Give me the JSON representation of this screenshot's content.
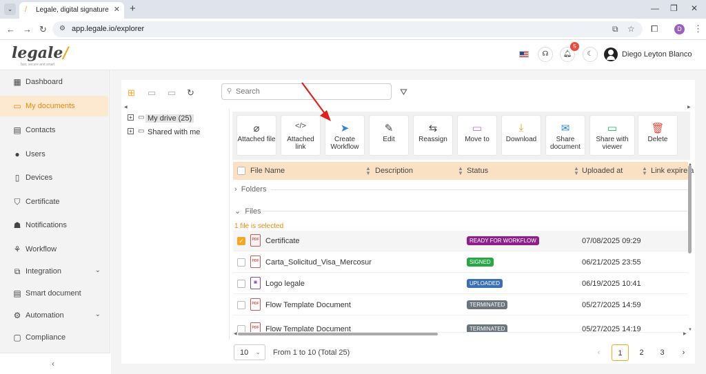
{
  "browser": {
    "tab_title": "Legale, digital signature",
    "tab_close": "✕",
    "new_tab": "+",
    "url": "app.legale.io/explorer",
    "profile_initial": "D"
  },
  "header": {
    "logo_text": "legale",
    "logo_mark": "/",
    "logo_tagline": "fast, secure and smart",
    "notification_count": "5",
    "user_name": "Diego Leyton Blanco"
  },
  "sidebar": {
    "items": [
      {
        "label": "Dashboard",
        "icon": "dashboard-icon"
      },
      {
        "label": "My documents",
        "icon": "folder-icon"
      },
      {
        "label": "Contacts",
        "icon": "contacts-icon"
      },
      {
        "label": "Users",
        "icon": "user-icon"
      },
      {
        "label": "Devices",
        "icon": "device-icon"
      },
      {
        "label": "Certificate",
        "icon": "shield-check-icon"
      },
      {
        "label": "Notifications",
        "icon": "bell-icon"
      },
      {
        "label": "Workflow",
        "icon": "workflow-icon"
      },
      {
        "label": "Integration",
        "icon": "external-link-icon"
      },
      {
        "label": "Smart document",
        "icon": "document-icon"
      },
      {
        "label": "Automation",
        "icon": "gear-icon"
      },
      {
        "label": "Compliance",
        "icon": "chat-icon"
      }
    ],
    "collapse_glyph": "‹"
  },
  "toolbar": {
    "search_placeholder": "Search"
  },
  "tree": {
    "my_drive": "My drive (25)",
    "shared": "Shared with me"
  },
  "actions": [
    {
      "label": "Attached file",
      "icon": "paperclip-icon",
      "glyph": "⌀",
      "color": "#444444"
    },
    {
      "label": "Attached link",
      "icon": "code-icon",
      "glyph": "</>",
      "color": "#444444"
    },
    {
      "label": "Create Workflow",
      "icon": "send-icon",
      "glyph": "➤",
      "color": "#2e86de"
    },
    {
      "label": "Edit",
      "icon": "edit-icon",
      "glyph": "✎",
      "color": "#444444"
    },
    {
      "label": "Reassign",
      "icon": "reassign-icon",
      "glyph": "⇆",
      "color": "#444444"
    },
    {
      "label": "Move to",
      "icon": "move-folder-icon",
      "glyph": "▭",
      "color": "#c56cd6"
    },
    {
      "label": "Download",
      "icon": "download-icon",
      "glyph": "⤓",
      "color": "#f39c12"
    },
    {
      "label": "Share document",
      "icon": "mail-icon",
      "glyph": "✉",
      "color": "#2e86de"
    },
    {
      "label": "Share with viewer",
      "icon": "share-folder-icon",
      "glyph": "▭",
      "color": "#27ae60"
    },
    {
      "label": "Delete",
      "icon": "trash-icon",
      "glyph": "🗑",
      "color": "#e74c3c"
    }
  ],
  "table": {
    "headers": {
      "file_name": "File Name",
      "description": "Description",
      "status": "Status",
      "uploaded_at": "Uploaded at",
      "link_expire": "Link expire a"
    },
    "folders_label": "Folders",
    "files_label": "Files",
    "selection_info": "1 file is selected",
    "rows": [
      {
        "name": "Certificate",
        "type": "pdf",
        "status": "READY FOR WORKFLOW",
        "status_color": "#8e1f8c",
        "uploaded_at": "07/08/2025 09:29",
        "checked": true
      },
      {
        "name": "Carta_Solicitud_Visa_Mercosur",
        "type": "pdf",
        "status": "SIGNED",
        "status_color": "#27a844",
        "uploaded_at": "06/21/2025 23:55",
        "checked": false
      },
      {
        "name": "Logo legale",
        "type": "img",
        "status": "UPLOADED",
        "status_color": "#3a6fb7",
        "uploaded_at": "06/19/2025 10:41",
        "checked": false
      },
      {
        "name": "Flow Template Document",
        "type": "pdf",
        "status": "TERMINATED",
        "status_color": "#6c757d",
        "uploaded_at": "05/27/2025 14:59",
        "checked": false
      },
      {
        "name": "Flow Template Document",
        "type": "pdf",
        "status": "TERMINATED",
        "status_color": "#6c757d",
        "uploaded_at": "05/27/2025 14:19",
        "checked": false
      }
    ]
  },
  "pagination": {
    "page_size": "10",
    "range_text": "From 1 to 10 (Total 25)",
    "pages": [
      "1",
      "2",
      "3"
    ],
    "current": "1"
  },
  "colors": {
    "accent": "#f5a623",
    "header_row": "#fbe1c3",
    "annotation_arrow": "#e0201b"
  }
}
